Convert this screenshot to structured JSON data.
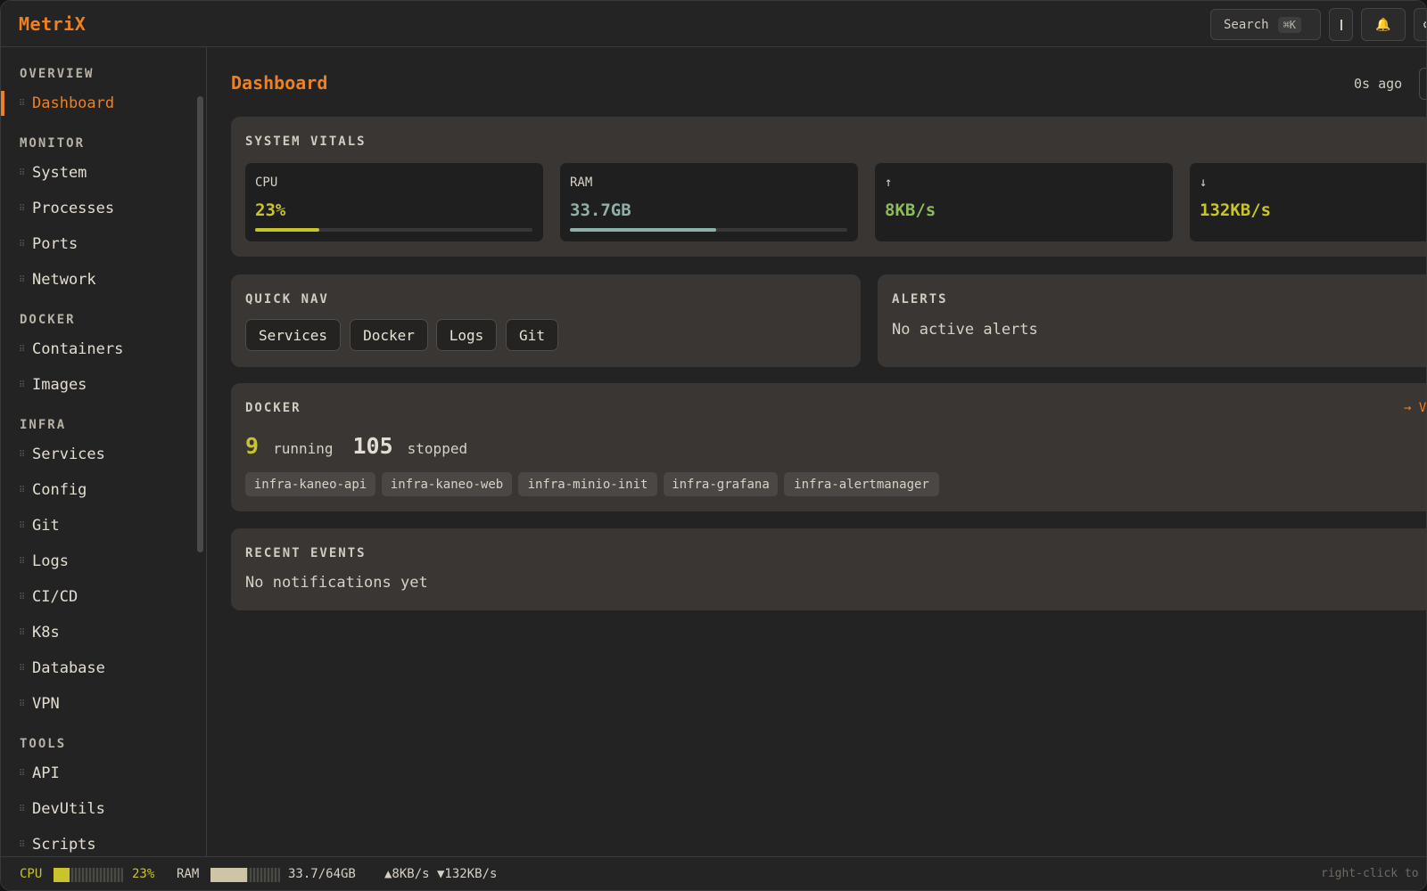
{
  "app": {
    "name": "MetriX"
  },
  "topbar": {
    "search_label": "Search",
    "search_shortcut": "⌘K",
    "notification_icon": "🔔",
    "settings_icon": "⚙"
  },
  "sidebar": {
    "sections": [
      {
        "title": "OVERVIEW",
        "items": [
          "Dashboard"
        ]
      },
      {
        "title": "MONITOR",
        "items": [
          "System",
          "Processes",
          "Ports",
          "Network"
        ]
      },
      {
        "title": "DOCKER",
        "items": [
          "Containers",
          "Images"
        ]
      },
      {
        "title": "INFRA",
        "items": [
          "Services",
          "Config",
          "Git",
          "Logs",
          "CI/CD",
          "K8s",
          "Database",
          "VPN"
        ]
      },
      {
        "title": "TOOLS",
        "items": [
          "API",
          "DevUtils",
          "Scripts"
        ]
      }
    ],
    "active_item": "Dashboard",
    "grip_glyph": "⠿"
  },
  "main": {
    "title": "Dashboard",
    "updated": "0s ago",
    "vitals": {
      "title": "SYSTEM VITALS",
      "cpu": {
        "label": "CPU",
        "value": "23%",
        "fill": 0.23,
        "color": "#c8c42a"
      },
      "ram": {
        "label": "RAM",
        "value": "33.7GB",
        "fill": 0.527,
        "color": "#8fb0a9"
      },
      "up": {
        "label": "↑",
        "value": "8KB/s",
        "color": "#8dbd5a"
      },
      "down": {
        "label": "↓",
        "value": "132KB/s",
        "color": "#c8c42a"
      }
    },
    "quick_nav": {
      "title": "QUICK NAV",
      "buttons": [
        "Services",
        "Docker",
        "Logs",
        "Git"
      ]
    },
    "alerts": {
      "title": "ALERTS",
      "empty_text": "No active alerts"
    },
    "docker": {
      "title": "DOCKER",
      "link_label": "→ V",
      "running_count": "9",
      "running_label": "running",
      "stopped_count": "105",
      "stopped_label": "stopped",
      "containers": [
        "infra-kaneo-api",
        "infra-kaneo-web",
        "infra-minio-init",
        "infra-grafana",
        "infra-alertmanager"
      ]
    },
    "recent_events": {
      "title": "RECENT EVENTS",
      "empty_text": "No notifications yet"
    }
  },
  "statusbar": {
    "cpu_label": "CPU",
    "cpu_value": "23%",
    "cpu_fill": 0.23,
    "ram_label": "RAM",
    "ram_value": "33.7/64GB",
    "ram_fill": 0.527,
    "net": "▲8KB/s ▼132KB/s",
    "hint": "right-click to"
  },
  "colors": {
    "accent": "#f0801f",
    "yellow": "#c8c42a",
    "green": "#8dbd5a",
    "teal": "#8fb0a9"
  }
}
